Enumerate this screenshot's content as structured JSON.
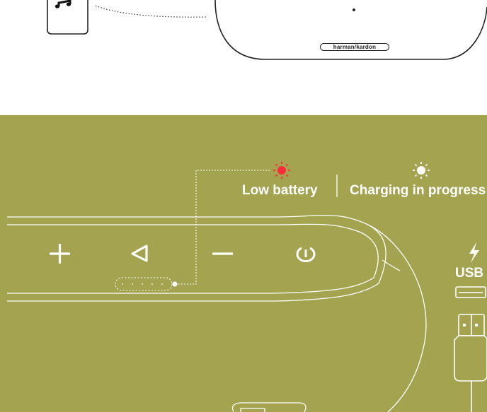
{
  "brand": {
    "logo_text": "harman/kardon"
  },
  "status": {
    "low_battery": {
      "label": "Low battery",
      "led_color": "#ff2a3c"
    },
    "charging": {
      "label": "Charging in progress",
      "led_color": "#ffffff"
    }
  },
  "port": {
    "label": "USB"
  },
  "colors": {
    "panel_bg": "#a3a350",
    "line": "#ffffff",
    "ink": "#222222"
  },
  "icons": [
    "music-note-icon",
    "plus-icon",
    "previous-icon",
    "minus-icon",
    "power-icon",
    "lightning-icon",
    "usb-port-icon",
    "usb-cable-icon",
    "led-icon"
  ]
}
